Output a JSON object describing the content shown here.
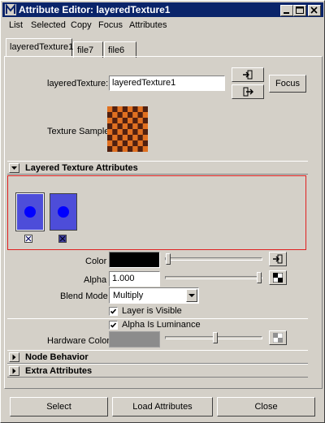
{
  "window": {
    "title": "Attribute Editor: layeredTexture1"
  },
  "menu": {
    "items": [
      "List",
      "Selected",
      "Copy",
      "Focus",
      "Attributes"
    ]
  },
  "tabs": [
    {
      "label": "layeredTexture1",
      "selected": true
    },
    {
      "label": "file7",
      "selected": false
    },
    {
      "label": "file6",
      "selected": false
    }
  ],
  "node": {
    "label": "layeredTexture:",
    "value": "layeredTexture1",
    "focus_label": "Focus",
    "sample_label": "Texture Sample"
  },
  "sections": {
    "layered": "Layered Texture Attributes",
    "node_behavior": "Node Behavior",
    "extra": "Extra Attributes"
  },
  "layers": [
    {
      "swatch_color": "#4d4dd9",
      "dot_color": "#0000ff",
      "selected": true
    },
    {
      "swatch_color": "#4d4dd9",
      "dot_color": "#0000ff",
      "selected": false
    }
  ],
  "attrs": {
    "color_label": "Color",
    "color_value": "#000000",
    "color_slider": 0.0,
    "alpha_label": "Alpha",
    "alpha_value": "1.000",
    "alpha_slider": 1.0,
    "blend_label": "Blend Mode",
    "blend_value": "Multiply",
    "layer_visible_label": "Layer is Visible",
    "layer_visible": true,
    "alpha_lum_label": "Alpha Is Luminance",
    "alpha_lum": true,
    "hw_color_label": "Hardware Color",
    "hw_color_value": "#8c8c8c",
    "hw_slider": 0.5
  },
  "buttons": {
    "select": "Select",
    "load": "Load Attributes",
    "close": "Close"
  },
  "colors": {
    "title_bg": "#0a246a",
    "panel_bg": "#d4d0c8",
    "layer_border": "#e02020",
    "checker_a": "#e07020",
    "checker_b": "#502010"
  }
}
